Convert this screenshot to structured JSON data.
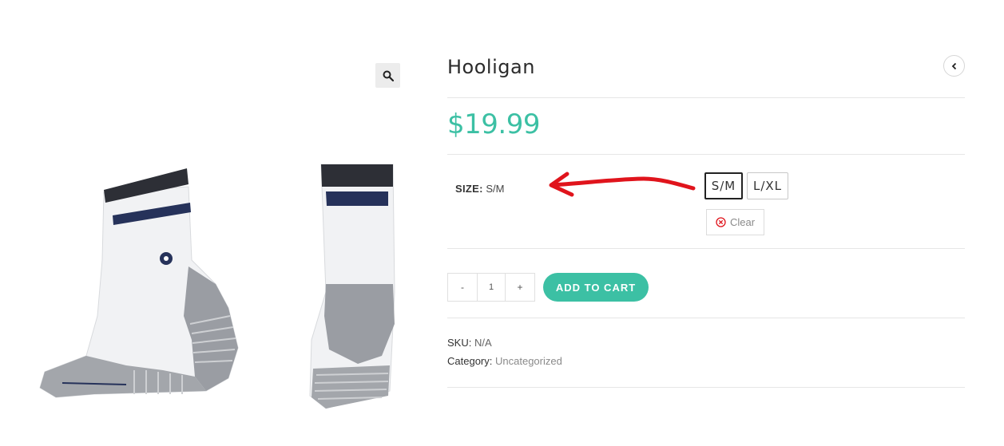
{
  "product": {
    "title": "Hooligan",
    "price": "$19.99"
  },
  "variations": {
    "label": "SIZE:",
    "selected_value": "S/M",
    "options": [
      "S/M",
      "L/XL"
    ],
    "selected_index": 0,
    "clear_label": "Clear"
  },
  "cart": {
    "minus_label": "-",
    "quantity": "1",
    "plus_label": "+",
    "add_to_cart_label": "ADD TO CART"
  },
  "meta": {
    "sku_label": "SKU:",
    "sku_value": "N/A",
    "category_label": "Category:",
    "category_value": "Uncategorized"
  },
  "icons": {
    "zoom": "magnifier-icon",
    "back": "chevron-left-icon",
    "clear": "circle-x-icon"
  },
  "colors": {
    "accent": "#3cc0a4",
    "annotation_arrow": "#e0141c",
    "sock_stripe_dark": "#2d2f36",
    "sock_stripe_navy": "#26325a",
    "sock_heel_gray": "#9a9da3"
  }
}
